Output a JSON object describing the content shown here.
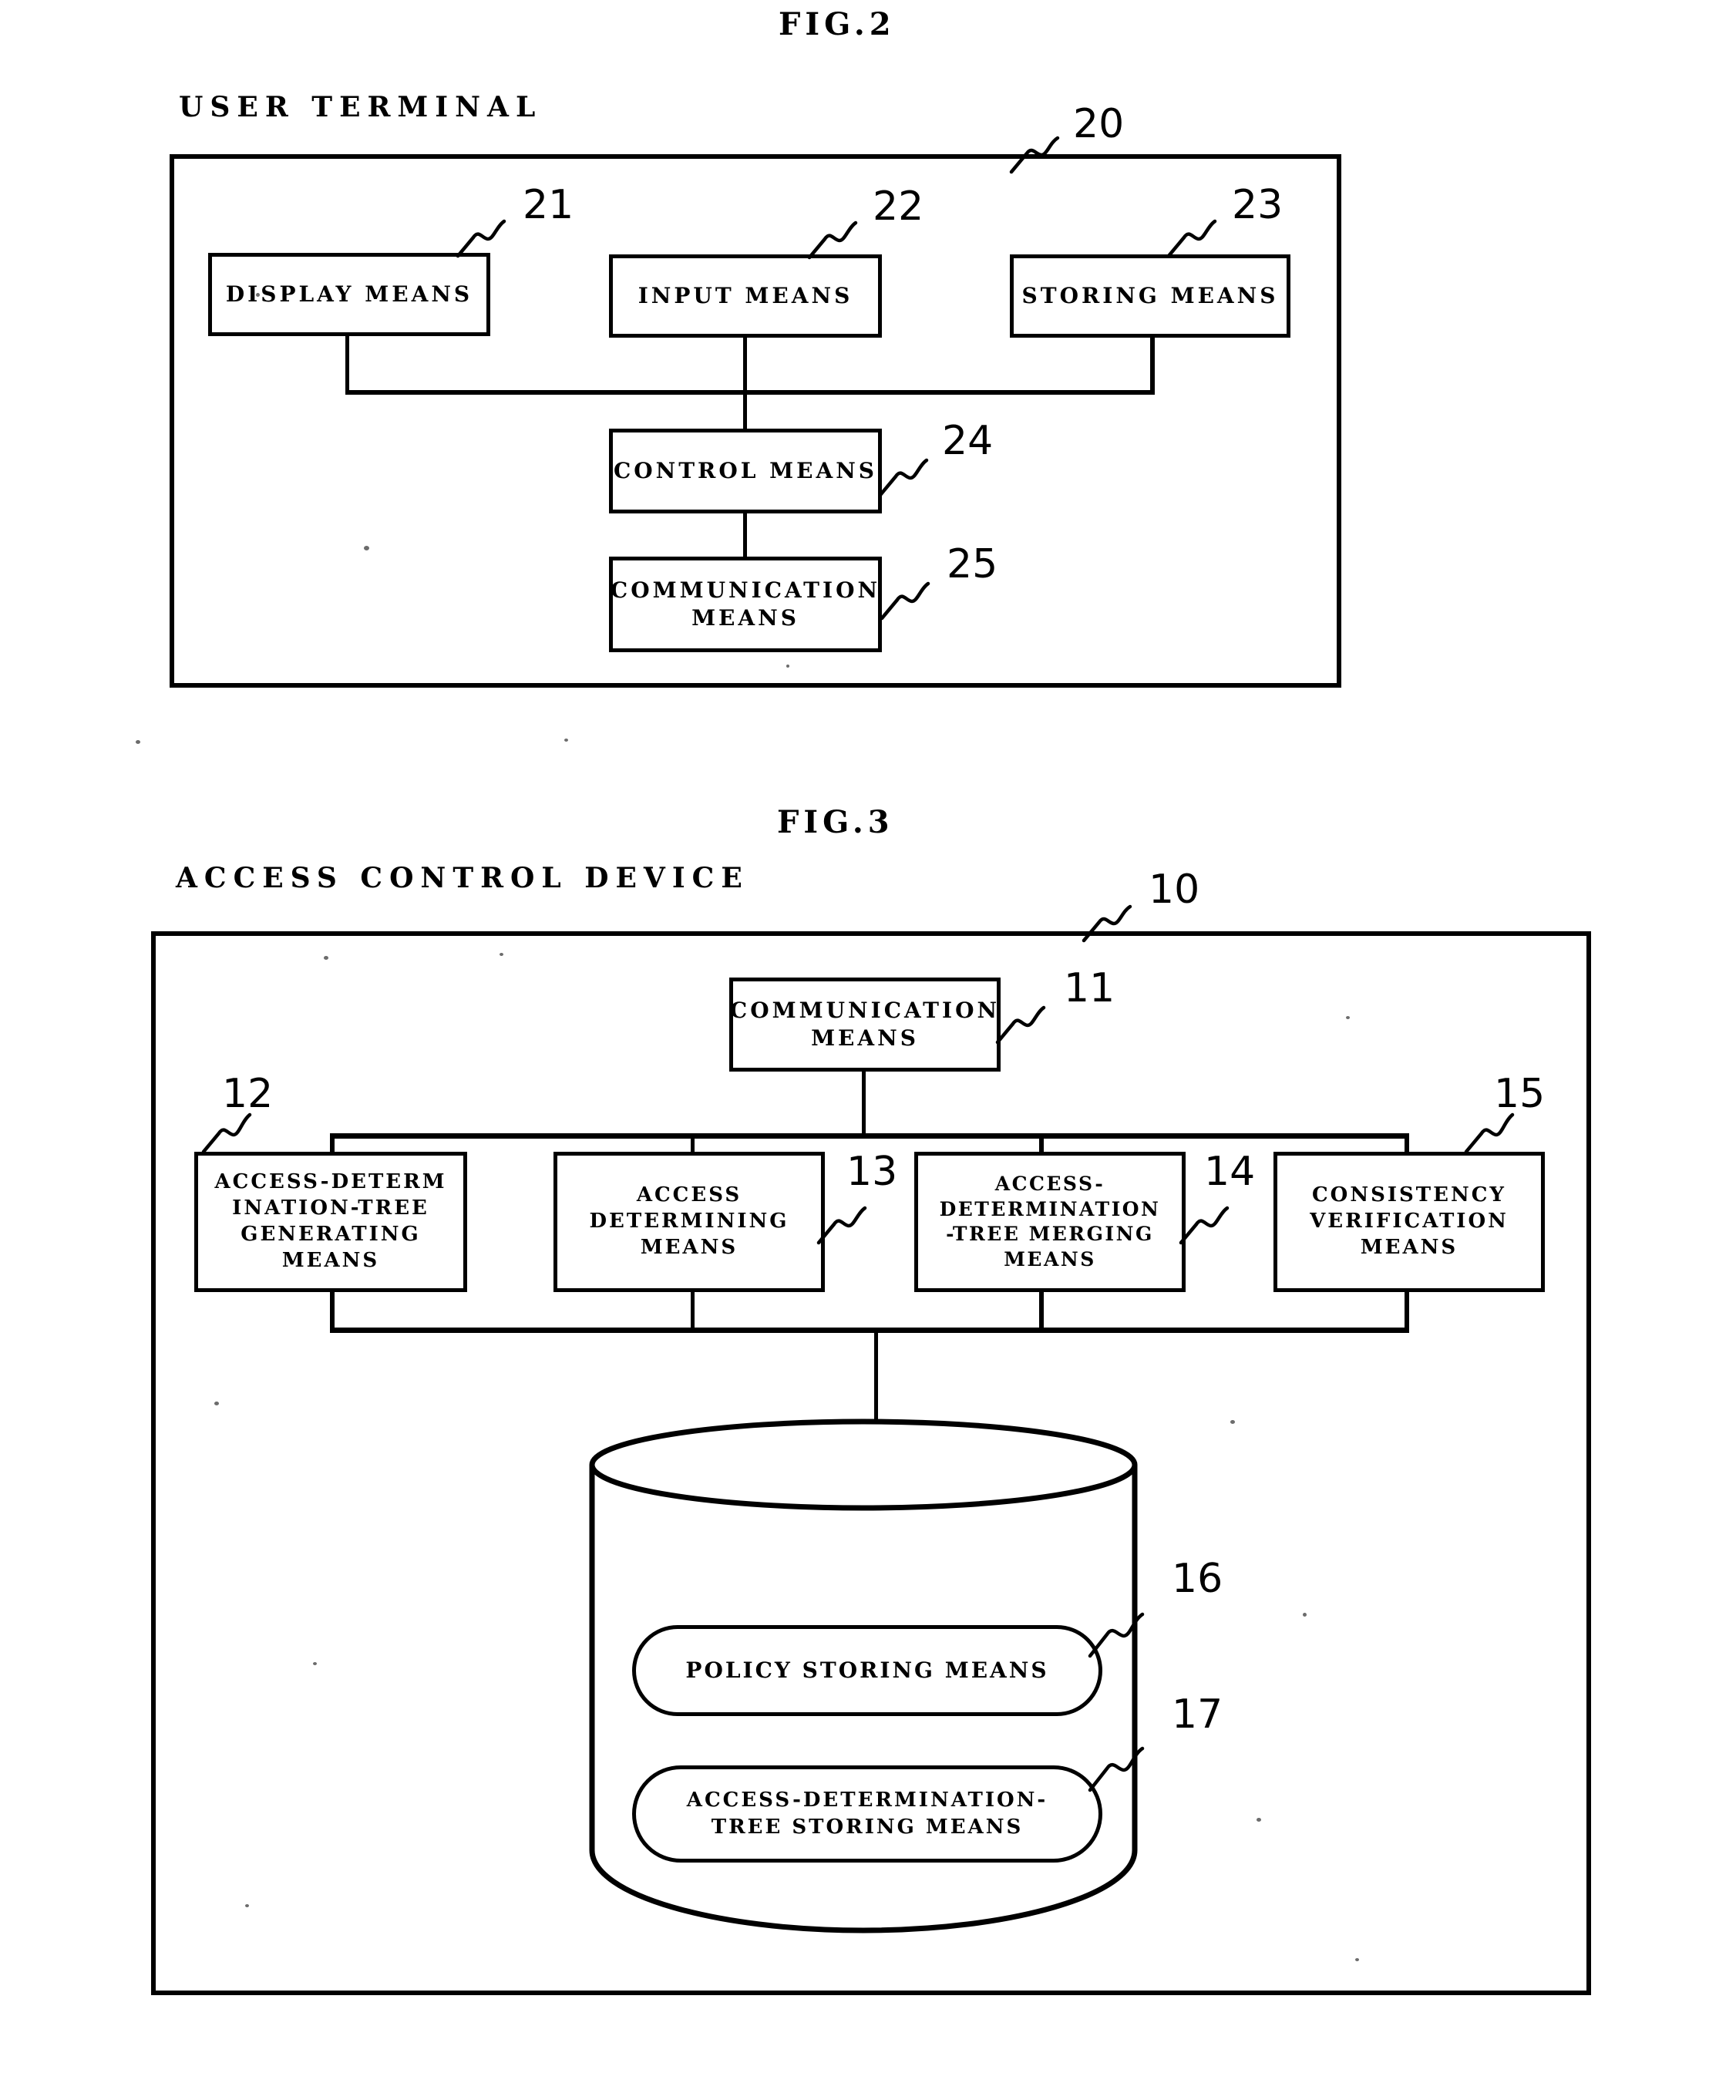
{
  "page": {
    "background_color": "#ffffff",
    "ink_color": "#000000"
  },
  "figures": [
    {
      "id": "fig2",
      "title": "FIG.2",
      "caption": "USER TERMINAL",
      "frame_ref": "20",
      "boxes": [
        {
          "ref": "21",
          "label": "DISPLAY MEANS"
        },
        {
          "ref": "22",
          "label": "INPUT MEANS"
        },
        {
          "ref": "23",
          "label": "STORING MEANS"
        },
        {
          "ref": "24",
          "label": "CONTROL MEANS"
        },
        {
          "ref": "25",
          "label": "COMMUNICATION\nMEANS"
        }
      ]
    },
    {
      "id": "fig3",
      "title": "FIG.3",
      "caption": "ACCESS CONTROL DEVICE",
      "frame_ref": "10",
      "boxes": [
        {
          "ref": "11",
          "label": "COMMUNICATION\nMEANS"
        },
        {
          "ref": "12",
          "label": "ACCESS-DETERM\nINATION-TREE\nGENERATING\nMEANS"
        },
        {
          "ref": "13",
          "label": "ACCESS\nDETERMINING\nMEANS"
        },
        {
          "ref": "14",
          "label": "ACCESS-\nDETERMINATION\n-TREE MERGING\nMEANS"
        },
        {
          "ref": "15",
          "label": "CONSISTENCY\nVERIFICATION\nMEANS"
        }
      ],
      "storage": {
        "shape": "cylinder",
        "pills": [
          {
            "ref": "16",
            "label": "POLICY STORING MEANS"
          },
          {
            "ref": "17",
            "label": "ACCESS-DETERMINATION-\nTREE STORING MEANS"
          }
        ]
      }
    }
  ]
}
